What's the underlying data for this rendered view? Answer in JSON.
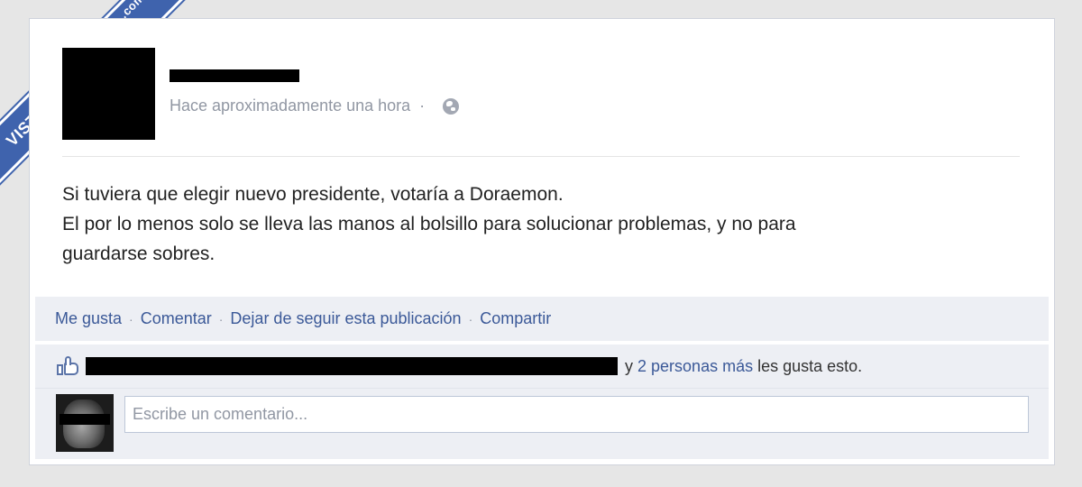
{
  "watermark": {
    "text": "VISTOENLASREDES",
    "suffix": ".com"
  },
  "post": {
    "timestamp": "Hace aproximadamente una hora",
    "separator": "·",
    "privacy_icon": "globe-icon",
    "lines": [
      "Si tuviera que elegir nuevo presidente, votaría a Doraemon.",
      "El por lo menos solo se lleva las manos al bolsillo para solucionar problemas, y no para",
      "guardarse sobres."
    ]
  },
  "actions": {
    "like": "Me gusta",
    "comment": "Comentar",
    "unfollow": "Dejar de seguir esta publicación",
    "share": "Compartir",
    "separator": "·"
  },
  "likes": {
    "icon": "thumbs-up-icon",
    "connector": "y",
    "others_link": "2 personas más",
    "suffix": "les gusta esto."
  },
  "comment_box": {
    "placeholder": "Escribe un comentario..."
  },
  "colors": {
    "link": "#3b5998",
    "bar": "#edeff4",
    "badge": "#3f63ad"
  }
}
